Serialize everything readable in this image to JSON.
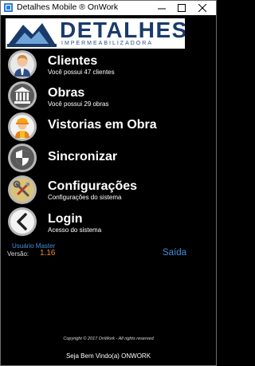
{
  "window": {
    "title": "Detalhes Mobile ® OnWork"
  },
  "logo": {
    "word": "DETALHES",
    "tagline": "IMPERMEABILIZADORA"
  },
  "menu": [
    {
      "id": "clientes",
      "label": "Clientes",
      "subtitle": "Você possui 47 clientes",
      "icon": "person-icon"
    },
    {
      "id": "obras",
      "label": "Obras",
      "subtitle": "Você possui 29 obras",
      "icon": "bank-icon"
    },
    {
      "id": "vistorias",
      "label": "Vistorias em Obra",
      "subtitle": "",
      "icon": "construction-worker-icon"
    },
    {
      "id": "sincronizar",
      "label": "Sincronizar",
      "subtitle": "",
      "icon": "shield-icon"
    },
    {
      "id": "configuracoes",
      "label": "Configurações",
      "subtitle": "Configurações do sistema",
      "icon": "tools-icon"
    },
    {
      "id": "login",
      "label": "Login",
      "subtitle": "Acesso do sistema",
      "icon": "chevron-left-icon"
    }
  ],
  "footer": {
    "user": "Usuário Master",
    "version_label": "Versão:",
    "version_value": "1.16",
    "logout": "Saída",
    "copyright": "Copyright © 2017 OnWork - All rights reserved",
    "welcome": "Seja Bem Vindo(a) ONWORK"
  },
  "colors": {
    "background": "#000000",
    "link": "#3f8fd8",
    "version": "#f08a2a",
    "icon_circle": "#b8b8b8"
  }
}
